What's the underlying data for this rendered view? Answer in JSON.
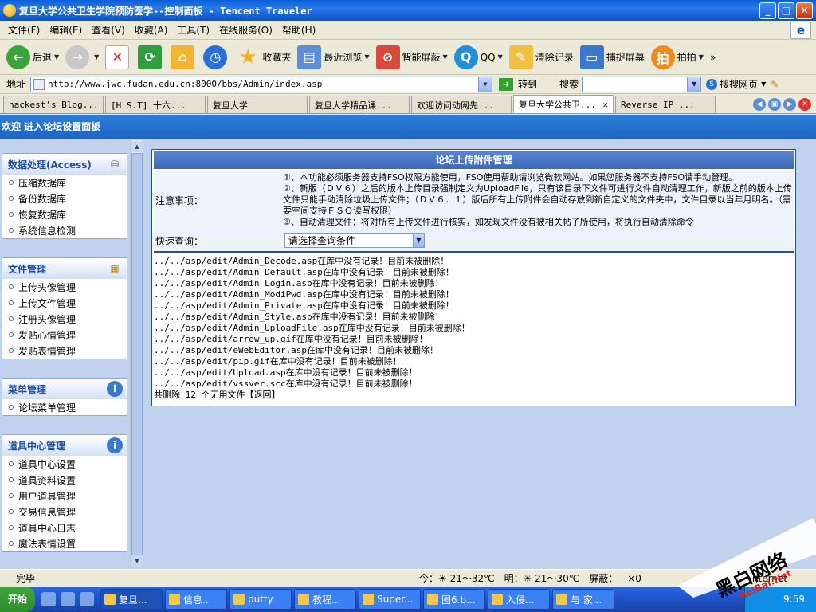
{
  "window": {
    "title": "复旦大学公共卫生学院预防医学--控制面板 - Tencent Traveler"
  },
  "menu": [
    "文件(F)",
    "编辑(E)",
    "查看(V)",
    "收藏(A)",
    "工具(T)",
    "在线服务(O)",
    "帮助(H)"
  ],
  "toolbar": {
    "back": "后退",
    "favorites": "收藏夹",
    "recent": "最近浏览",
    "smart_block": "智能屏蔽",
    "qq": "QQ",
    "clear": "清除记录",
    "capture": "捕捉屏幕",
    "paipai": "拍拍",
    "more": "»"
  },
  "address": {
    "label": "地址",
    "url": "http://www.jwc.fudan.edu.cn:8000/bbs/Admin/index.asp",
    "go": "转到",
    "search_label": "搜索",
    "search_engine": "搜搜网页"
  },
  "tabs": [
    "hackest's Blog...",
    "[H.S.T] 十六...",
    "复旦大学",
    "复旦大学精品课...",
    "欢迎访问动网先...",
    "复旦大学公共卫...",
    "Reverse IP ..."
  ],
  "page": {
    "welcome": "欢迎 进入论坛设置面板"
  },
  "sidebar": {
    "panels": [
      {
        "title": "数据处理(Access)",
        "items": [
          "压缩数据库",
          "备份数据库",
          "恢复数据库",
          "系统信息检测"
        ]
      },
      {
        "title": "文件管理",
        "items": [
          "上传头像管理",
          "上传文件管理",
          "注册头像管理",
          "发贴心情管理",
          "发贴表情管理"
        ]
      },
      {
        "title": "菜单管理",
        "items": [
          "论坛菜单管理"
        ]
      },
      {
        "title": "道具中心管理",
        "items": [
          "道具中心设置",
          "道具资料设置",
          "用户道具管理",
          "交易信息管理",
          "道具中心日志",
          "魔法表情设置"
        ]
      }
    ]
  },
  "main": {
    "caption": "论坛上传附件管理",
    "notice_label": "注意事项：",
    "notice_lines": [
      "①、本功能必须服务器支持FSO权限方能使用，FSO使用帮助请浏览微软网站。如果您服务器不支持FSO请手动管理。",
      "②、新版（ＤＶ６）之后的版本上传目录强制定义为UploadFile，只有该目录下文件可进行文件自动清理工作，新版之前的版本上传文件只能手动清除垃圾上传文件；（ＤＶ６．１）版后所有上传附件会自动存放到新自定义的文件夹中，文件目录以当年月明名。（需要空间支持ＦＳＯ读写权限）",
      "③、自动清理文件：将对所有上传文件进行核实，如发现文件没有被相关帖子所使用，将执行自动清除命令"
    ],
    "quick_label": "快速查询：",
    "quick_select": "请选择查询条件",
    "log_lines": [
      "../../asp/edit/Admin_Decode.asp在库中没有记录！目前未被删除！",
      "../../asp/edit/Admin_Default.asp在库中没有记录！目前未被删除！",
      "../../asp/edit/Admin_Login.asp在库中没有记录！目前未被删除！",
      "../../asp/edit/Admin_ModiPwd.asp在库中没有记录！目前未被删除！",
      "../../asp/edit/Admin_Private.asp在库中没有记录！目前未被删除！",
      "../../asp/edit/Admin_Style.asp在库中没有记录！目前未被删除！",
      "../../asp/edit/Admin_UploadFile.asp在库中没有记录！目前未被删除！",
      "../../asp/edit/arrow_up.gif在库中没有记录！目前未被删除！",
      "../../asp/edit/eWebEditor.asp在库中没有记录！目前未被删除！",
      "../../asp/edit/pip.gif在库中没有记录！目前未被删除！",
      "../../asp/edit/Upload.asp在库中没有记录！目前未被删除！",
      "../../asp/edit/vssver.scc在库中没有记录！目前未被删除！"
    ],
    "summary": "共删除  12  个无用文件【返回】"
  },
  "status": {
    "text": "完毕",
    "today": "今：☀ 21～32℃",
    "tomorrow": "明：☀ 21～30℃",
    "block": "屏蔽：",
    "block_count": "×0",
    "zone": "Internet"
  },
  "taskbar": {
    "start": "开始",
    "items": [
      "复旦...",
      "信息...",
      "putty",
      "教程...",
      "Super...",
      "图6.b...",
      "入侵...",
      "与 家..."
    ],
    "clock": "9:59"
  },
  "watermark": {
    "text": "黑白网络",
    "sub": "HeiBai.Net"
  }
}
